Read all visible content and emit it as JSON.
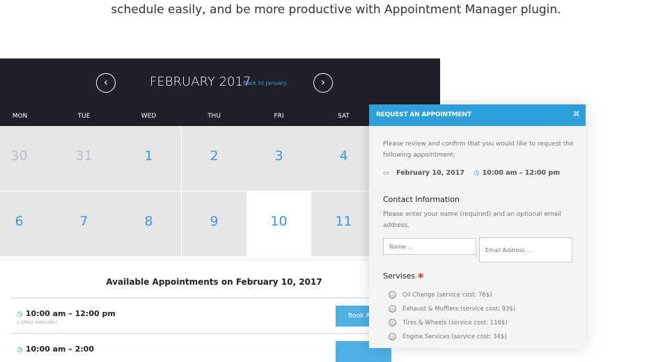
{
  "intro": "schedule easily, and be more productive with Appointment Manager plugin.",
  "calendar": {
    "month": "FEBRUARY 2017",
    "back_link": "Back to January",
    "prev": "‹",
    "next": "›",
    "weekdays": [
      "MON",
      "TUE",
      "WED",
      "THU",
      "FRI",
      "SAT"
    ],
    "row1": [
      "30",
      "31",
      "1",
      "2",
      "3",
      "4"
    ],
    "row2": [
      "6",
      "7",
      "8",
      "9",
      "10",
      "11"
    ],
    "selected": "10"
  },
  "available": {
    "title": "Available Appointments on February 10, 2017",
    "slots": [
      {
        "time": "10:00 am – 12:00 pm",
        "spaces": "1 SPACE AVAILABLE",
        "button": "Book Ap"
      },
      {
        "time": "10:00 am – 2:00",
        "button": ""
      }
    ]
  },
  "modal": {
    "title": "REQUEST AN APPOINTMENT",
    "close": "✖",
    "intro": "Please review and confirm that you would like to request the following appointment:",
    "date": "February 10, 2017",
    "time": "10:00 am – 12:00 pm",
    "contact_heading": "Contact Information",
    "contact_text": "Please enter your name (required) and an optional email address.",
    "name_placeholder": "Name ...",
    "email_placeholder": "Email Address ...",
    "services_heading": "Servises",
    "required_mark": "✱",
    "services": [
      "Oil Change (service cost: 76$)",
      "Exhaust & Mufflers (service cost: 93$)",
      "Tires & Wheels (service cost: 116$)",
      "Engine Services (service cost: 34$)"
    ]
  },
  "colors": {
    "header": "#1f2027",
    "accent": "#2d9fd9",
    "day": "#3b98d8"
  }
}
